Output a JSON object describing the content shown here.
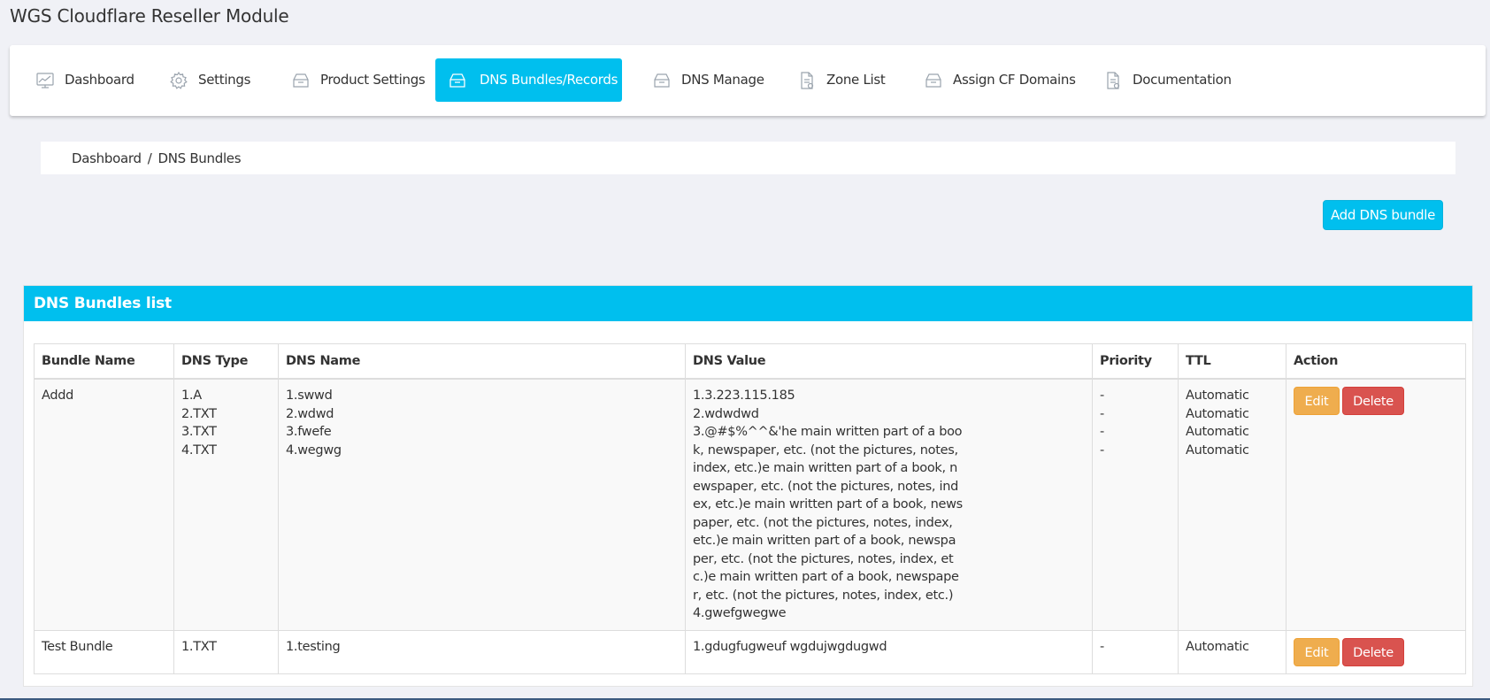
{
  "app": {
    "title": "WGS Cloudflare Reseller Module"
  },
  "nav": {
    "items": [
      {
        "label": "Dashboard",
        "icon": "chart-icon"
      },
      {
        "label": "Settings",
        "icon": "gear-icon"
      },
      {
        "label": "Product Settings",
        "icon": "inbox-icon"
      },
      {
        "label": "DNS Bundles/Records",
        "icon": "inbox-icon",
        "active": true
      },
      {
        "label": "DNS Manage",
        "icon": "inbox-icon"
      },
      {
        "label": "Zone List",
        "icon": "document-icon"
      },
      {
        "label": "Assign CF Domains",
        "icon": "inbox-icon"
      },
      {
        "label": "Documentation",
        "icon": "document-icon"
      }
    ]
  },
  "breadcrumb": {
    "home": "Dashboard",
    "separator": "/",
    "current": "DNS Bundles"
  },
  "actions": {
    "add_label": "Add DNS bundle"
  },
  "panel": {
    "title": "DNS Bundles list"
  },
  "table": {
    "headers": {
      "bundle_name": "Bundle Name",
      "dns_type": "DNS Type",
      "dns_name": "DNS Name",
      "dns_value": "DNS Value",
      "priority": "Priority",
      "ttl": "TTL",
      "action": "Action"
    },
    "rows": [
      {
        "bundle_name": "Addd",
        "dns_type": [
          "1.A",
          "2.TXT",
          "3.TXT",
          "4.TXT"
        ],
        "dns_name": [
          "1.swwd",
          "2.wdwd",
          "3.fwefe",
          "4.wegwg"
        ],
        "dns_value": [
          "1.3.223.115.185",
          "2.wdwdwd",
          "3.@#$%^^&'he main written part of a book, newspaper, etc. (not the pictures, notes, index, etc.)e main written part of a book, newspaper, etc. (not the pictures, notes, index, etc.)e main written part of a book, newspaper, etc. (not the pictures, notes, index, etc.)e main written part of a book, newspaper, etc. (not the pictures, notes, index, etc.)e main written part of a book, newspaper, etc. (not the pictures, notes, index, etc.)",
          "4.gwefgwegwe"
        ],
        "priority": [
          "-",
          "-",
          "-",
          "-"
        ],
        "ttl": [
          "Automatic",
          "Automatic",
          "Automatic",
          "Automatic"
        ],
        "edit_label": "Edit",
        "delete_label": "Delete"
      },
      {
        "bundle_name": "Test Bundle",
        "dns_type": [
          "1.TXT"
        ],
        "dns_name": [
          "1.testing"
        ],
        "dns_value": [
          "1.gdugfugweuf wgdujwgdugwd"
        ],
        "priority": [
          "-"
        ],
        "ttl": [
          "Automatic"
        ],
        "edit_label": "Edit",
        "delete_label": "Delete"
      }
    ]
  },
  "colors": {
    "accent": "#00bfee",
    "edit": "#efad4e",
    "delete": "#d9534f",
    "background": "#f0f1f6"
  }
}
